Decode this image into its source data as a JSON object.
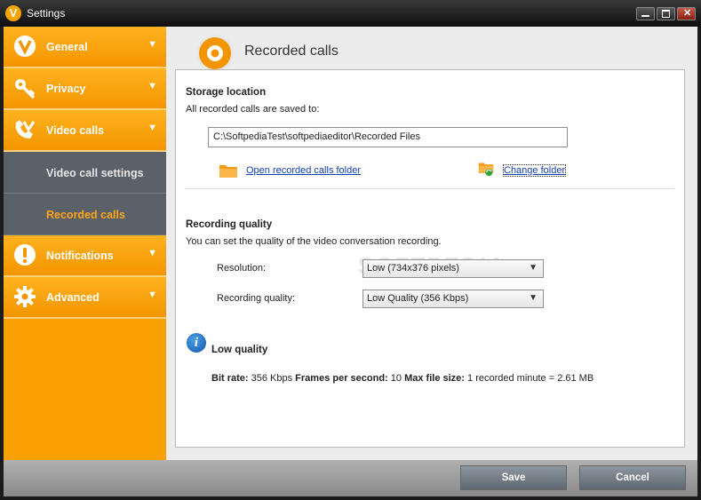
{
  "window": {
    "title": "Settings"
  },
  "sidebar": {
    "items": [
      {
        "label": "General",
        "icon": "v-logo-icon"
      },
      {
        "label": "Privacy",
        "icon": "key-icon"
      },
      {
        "label": "Video calls",
        "icon": "video-calls-icon"
      },
      {
        "label": "Notifications",
        "icon": "exclamation-icon"
      },
      {
        "label": "Advanced",
        "icon": "gear-icon"
      }
    ],
    "subitems": [
      {
        "label": "Video call settings",
        "active": false
      },
      {
        "label": "Recorded calls",
        "active": true
      }
    ]
  },
  "page": {
    "title": "Recorded calls",
    "storage": {
      "title": "Storage location",
      "desc": "All recorded calls are saved to:",
      "path": "C:\\SoftpediaTest\\softpediaeditor\\Recorded Files",
      "open_link": "Open recorded calls folder",
      "change_link": "Change folder"
    },
    "quality": {
      "title": "Recording quality",
      "desc": "You can set the quality of the video conversation recording.",
      "resolution_label": "Resolution:",
      "resolution_value": "Low (734x376 pixels)",
      "quality_label": "Recording quality:",
      "quality_value": "Low Quality (356 Kbps)"
    },
    "info": {
      "title": "Low quality",
      "bitrate_label": "Bit rate:",
      "bitrate_value": "356 Kbps",
      "fps_label": "Frames per second:",
      "fps_value": "10",
      "maxsize_label": "Max file size:",
      "maxsize_value": "1 recorded minute = 2.61 MB"
    },
    "watermark": "SOFTPEDIA"
  },
  "footer": {
    "save": "Save",
    "cancel": "Cancel"
  },
  "colors": {
    "accent": "#f7a000",
    "link": "#0f3fb5",
    "sub_bg": "#5b6168"
  }
}
